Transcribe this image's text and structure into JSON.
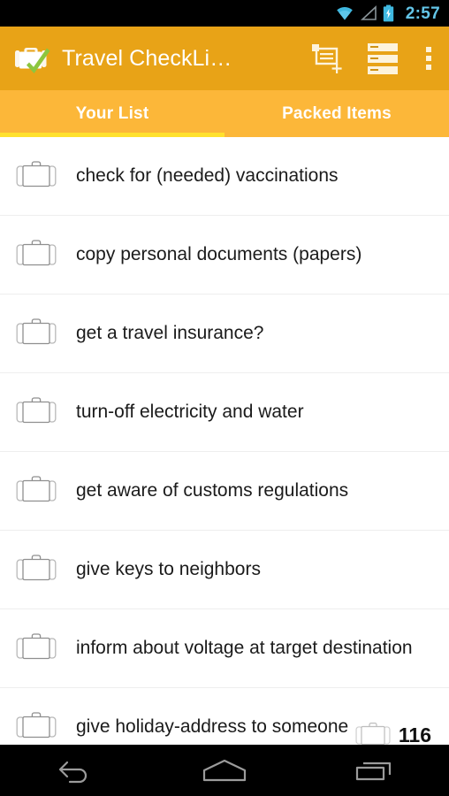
{
  "status_bar": {
    "clock": "2:57",
    "icons": [
      "wifi-icon",
      "signal-icon",
      "battery-charging-icon"
    ],
    "background": "#000000",
    "clock_color": "#63c5e8"
  },
  "action_bar": {
    "app_icon": "suitcase-check-icon",
    "title": "Travel CheckLi…",
    "background": "#e8a317",
    "title_color": "#ffffff",
    "actions": [
      {
        "name": "add-list-icon",
        "label": "Add list"
      },
      {
        "name": "list-view-icon",
        "label": "Lists"
      },
      {
        "name": "overflow-menu-icon",
        "label": "More options"
      }
    ]
  },
  "tabs": {
    "background": "#fcb739",
    "indicator_color": "#ffe12e",
    "selected_index": 0,
    "items": [
      {
        "label": "Your List"
      },
      {
        "label": "Packed Items"
      }
    ]
  },
  "list": {
    "item_icon": "suitcase-outline-icon",
    "divider_color": "#eeeeee",
    "text_color": "#1b1b1b",
    "items": [
      {
        "label": "check for (needed) vaccinations"
      },
      {
        "label": "copy personal documents (papers)"
      },
      {
        "label": "get a travel insurance?"
      },
      {
        "label": "turn-off electricity and water"
      },
      {
        "label": "get aware of customs regulations"
      },
      {
        "label": "give keys to neighbors"
      },
      {
        "label": "inform about voltage at target destination"
      },
      {
        "label": "give holiday-address to someone"
      }
    ]
  },
  "count_badge": {
    "icon": "suitcase-outline-icon",
    "value": "116"
  },
  "nav_bar": {
    "background": "#000000",
    "icon_color": "#9b9b9b",
    "buttons": [
      {
        "name": "nav-back-button",
        "label": "Back"
      },
      {
        "name": "nav-home-button",
        "label": "Home"
      },
      {
        "name": "nav-recents-button",
        "label": "Recent apps"
      }
    ]
  }
}
